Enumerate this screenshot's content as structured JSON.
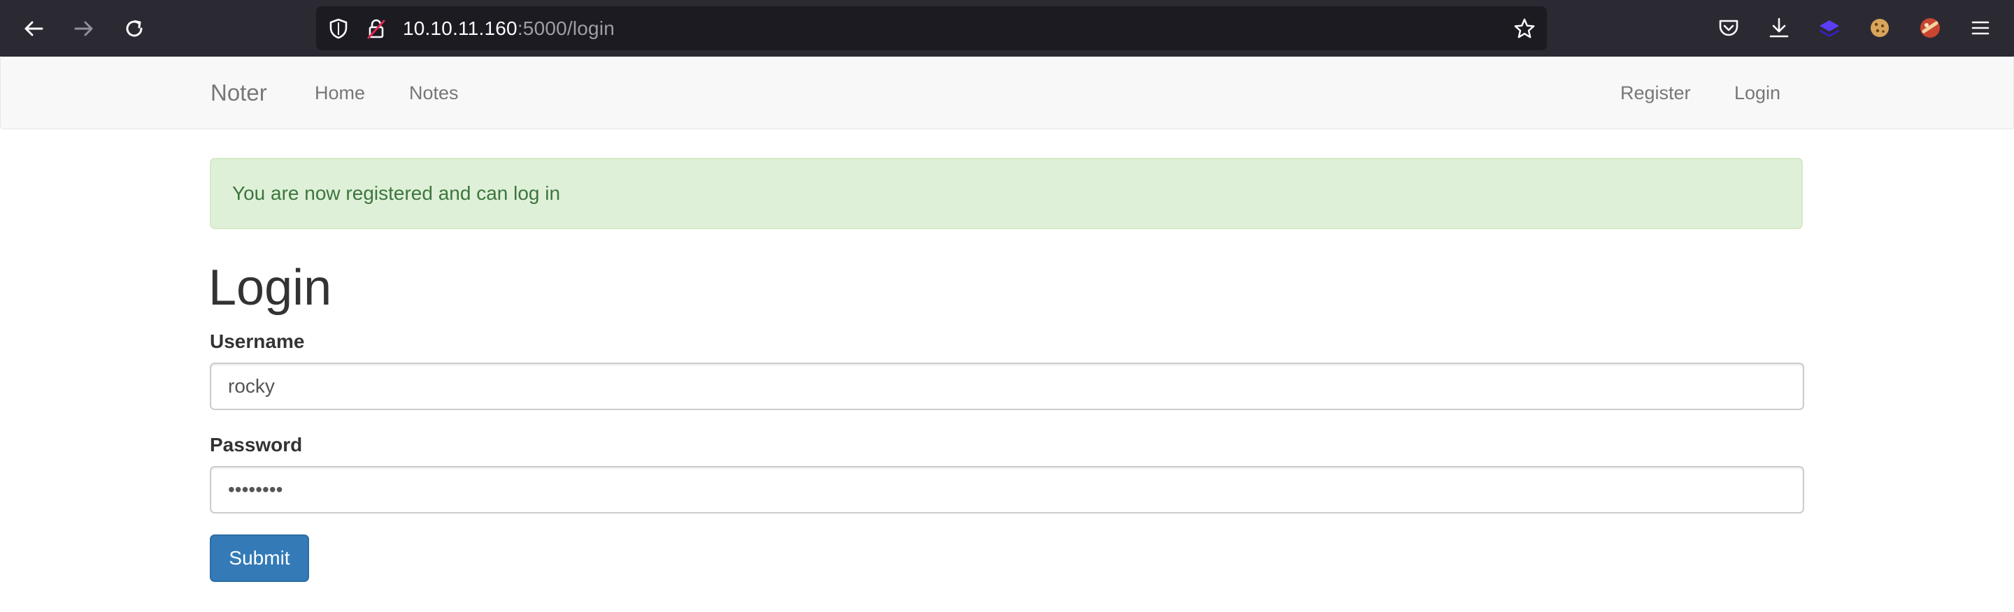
{
  "browser": {
    "url_host": "10.10.11.160",
    "url_path": ":5000/login",
    "icons": {
      "back": "back-arrow-icon",
      "forward": "forward-arrow-icon",
      "reload": "reload-icon",
      "shield": "tracking-protection-shield-icon",
      "lock": "insecure-lock-icon",
      "bookmark": "bookmark-star-icon",
      "pocket": "pocket-icon",
      "downloads": "download-icon",
      "extension1": "extension-icon",
      "extension2": "cookie-extension-icon",
      "extension3": "extension-icon",
      "menu": "hamburger-menu-icon"
    }
  },
  "navbar": {
    "brand": "Noter",
    "left_links": [
      "Home",
      "Notes"
    ],
    "right_links": [
      "Register",
      "Login"
    ]
  },
  "alert": {
    "message": "You are now registered and can log in"
  },
  "form": {
    "title": "Login",
    "username_label": "Username",
    "username_value": "rocky",
    "password_label": "Password",
    "password_value": "********",
    "submit_label": "Submit"
  },
  "colors": {
    "browser_bar": "#2b2a33",
    "urlbar": "#1c1b22",
    "navbar_bg": "#f8f8f8",
    "alert_bg": "#dff0d8",
    "alert_text": "#3c763d",
    "primary_button": "#337ab7"
  }
}
